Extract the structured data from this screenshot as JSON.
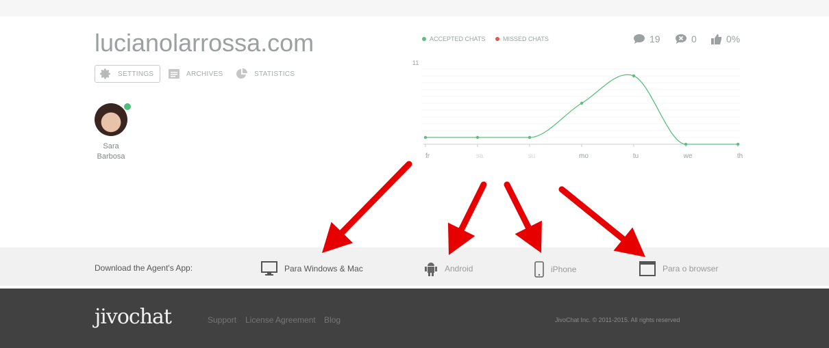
{
  "site_title": "lucianolarrossa.com",
  "nav": {
    "settings": "SETTINGS",
    "archives": "ARCHIVES",
    "statistics": "STATISTICS"
  },
  "agent": {
    "first": "Sara",
    "last": "Barbosa",
    "status": "online"
  },
  "legend": {
    "accepted": "ACCEPTED CHATS",
    "missed": "MISSED CHATS"
  },
  "stats": {
    "chats": "19",
    "missed": "0",
    "rating": "0%"
  },
  "colors": {
    "accepted": "#5cbf7f",
    "missed": "#e0574f",
    "arrow": "#e60000"
  },
  "chart_data": {
    "type": "line",
    "categories": [
      "fr",
      "sa",
      "su",
      "mo",
      "tu",
      "we",
      "th"
    ],
    "series": [
      {
        "name": "ACCEPTED CHATS",
        "values": [
          1,
          1,
          1,
          6,
          10,
          0,
          0
        ]
      }
    ],
    "y_tick_max": "11",
    "ylim": [
      0,
      11
    ],
    "grid": true
  },
  "download": {
    "label": "Download the Agent's App:",
    "apps": [
      "Para Windows & Mac",
      "Android",
      "iPhone",
      "Para o browser"
    ]
  },
  "footer": {
    "logo": "jivochat",
    "links": [
      "Support",
      "License Agreement",
      "Blog"
    ],
    "copyright": "JivoChat Inc. © 2011-2015. All rights reserved"
  }
}
